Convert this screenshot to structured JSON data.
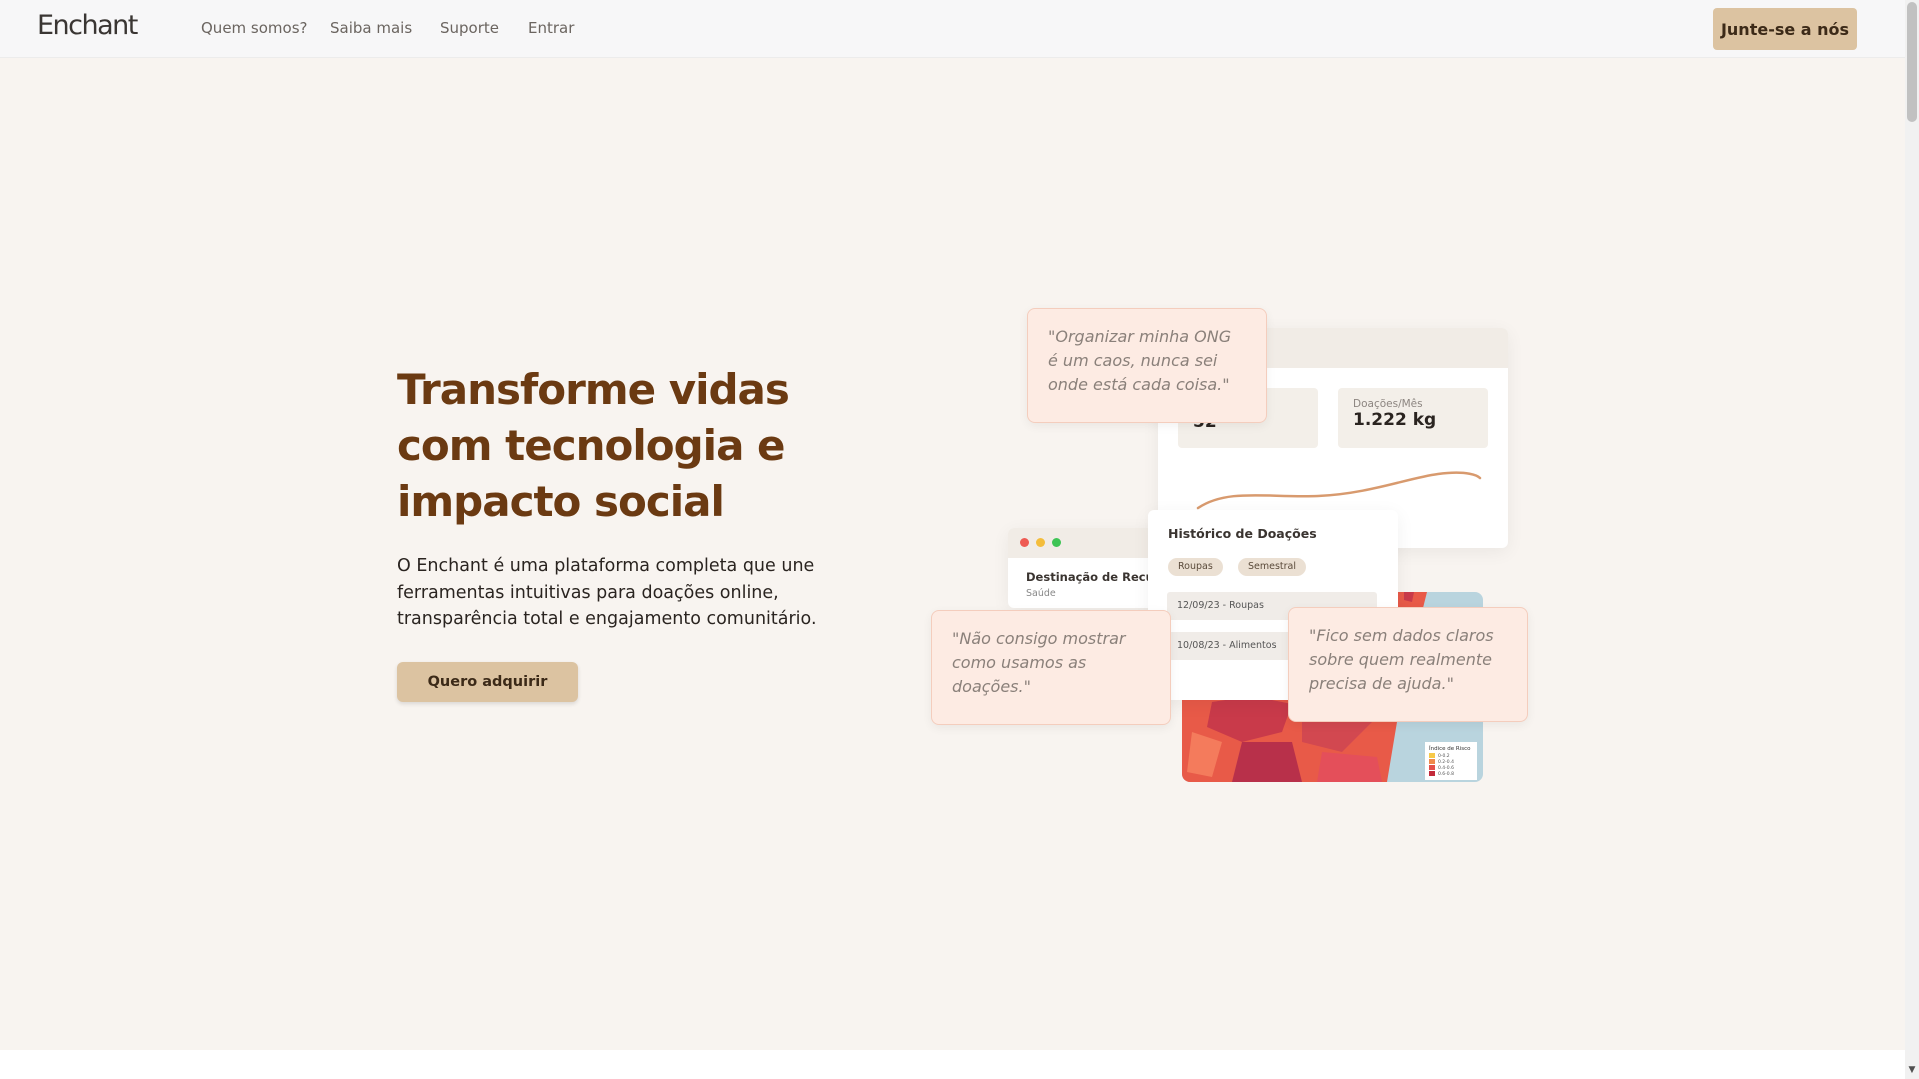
{
  "header": {
    "logo": "Enchant",
    "nav": [
      "Quem somos?",
      "Saiba mais",
      "Suporte",
      "Entrar"
    ],
    "cta": "Junte-se a nós"
  },
  "hero": {
    "title": "Transforme vidas com tecnologia e impacto social",
    "description": "O Enchant é uma plataforma completa que une ferramentas intuitivas para doações online, transparência total e engajamento comunitário.",
    "button": "Quero adquirir"
  },
  "mockup": {
    "stat1_value": "52",
    "stat2_label": "Doações/Mês",
    "stat2_value": "1.222 kg",
    "history_title": "Histórico de Doações",
    "chips": [
      "Roupas",
      "Semestral"
    ],
    "history_rows": [
      "12/09/23 - Roupas",
      "10/08/23 - Alimentos"
    ],
    "dest_title": "Destinação de Recursos",
    "dest_sub": "Saúde",
    "map_legend_title": "Índice de Risco",
    "map_legend_items": [
      "0-0.2",
      "0.2-0.4",
      "0.4-0.6",
      "0.6-0.8"
    ],
    "window_dots": [
      "#ee5a52",
      "#f4bd3b",
      "#3ec455"
    ]
  },
  "quotes": [
    "\"Organizar minha ONG é um caos, nunca sei onde está cada coisa.\"",
    "\"Não consigo mostrar como usamos as doações.\"",
    "\"Fico sem dados claros sobre quem realmente precisa de ajuda.\""
  ],
  "colors": {
    "accent": "#dcc3a1",
    "title": "#6b3a12",
    "quote_bg": "#fdebe3"
  }
}
